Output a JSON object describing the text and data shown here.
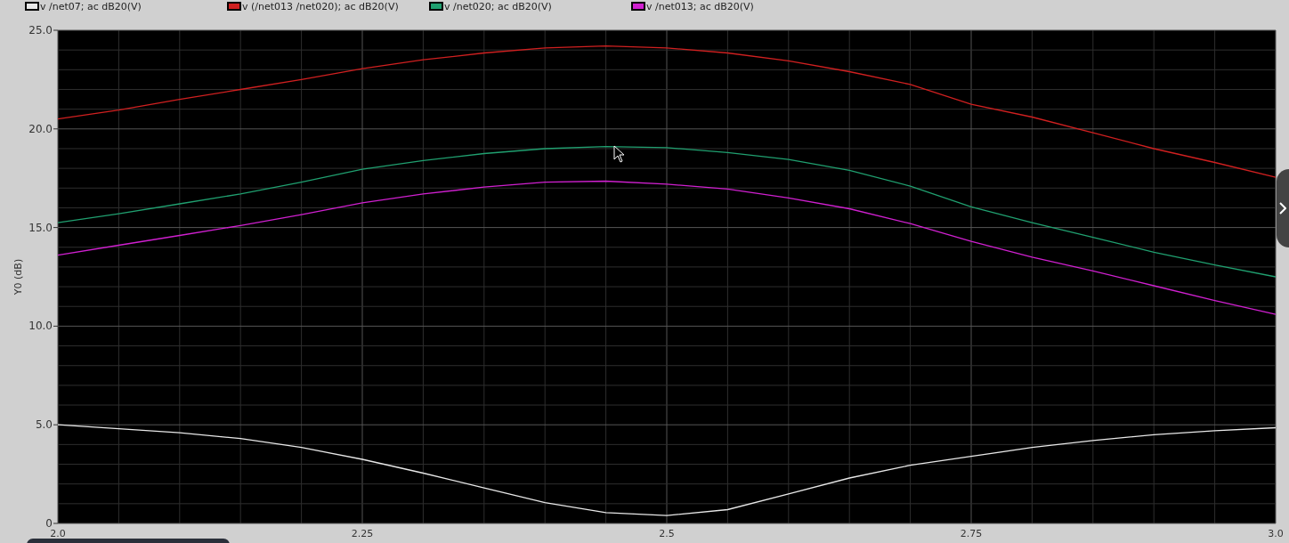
{
  "plot": {
    "chart_data": {
      "type": "line",
      "ylabel": "Y0 (dB)",
      "grid": true,
      "x": [
        2.0,
        2.05,
        2.1,
        2.15,
        2.2,
        2.25,
        2.3,
        2.35,
        2.4,
        2.45,
        2.5,
        2.55,
        2.6,
        2.65,
        2.7,
        2.75,
        2.8,
        2.85,
        2.9,
        2.95,
        3.0
      ],
      "series": [
        {
          "name": "v /net07; ac dB20(V)",
          "color": "#e8e8e8",
          "values": [
            5.0,
            4.8,
            4.6,
            4.3,
            3.85,
            3.25,
            2.55,
            1.8,
            1.05,
            0.55,
            0.4,
            0.7,
            1.5,
            2.3,
            2.95,
            3.4,
            3.85,
            4.2,
            4.5,
            4.7,
            4.85
          ]
        },
        {
          "name": "v (/net013 /net020); ac dB20(V)",
          "color": "#d02020",
          "values": [
            20.5,
            20.95,
            21.5,
            22.0,
            22.5,
            23.05,
            23.5,
            23.85,
            24.1,
            24.2,
            24.1,
            23.85,
            23.45,
            22.9,
            22.25,
            21.25,
            20.6,
            19.8,
            19.0,
            18.3,
            17.55
          ]
        },
        {
          "name": "v /net020; ac dB20(V)",
          "color": "#20a070",
          "values": [
            15.25,
            15.7,
            16.2,
            16.7,
            17.3,
            17.95,
            18.4,
            18.75,
            19.0,
            19.1,
            19.05,
            18.8,
            18.45,
            17.9,
            17.1,
            16.05,
            15.25,
            14.5,
            13.75,
            13.1,
            12.5
          ]
        },
        {
          "name": "v /net013; ac dB20(V)",
          "color": "#d020d0",
          "values": [
            13.6,
            14.1,
            14.6,
            15.1,
            15.65,
            16.25,
            16.7,
            17.05,
            17.3,
            17.35,
            17.2,
            16.95,
            16.5,
            15.95,
            15.2,
            14.3,
            13.5,
            12.8,
            12.05,
            11.3,
            10.6
          ]
        }
      ],
      "xlim": [
        2.0,
        3.0
      ],
      "ylim": [
        0,
        25
      ],
      "xticks": [
        {
          "value": 2.0,
          "label": "2.0"
        },
        2.25,
        2.5,
        2.75,
        {
          "value": 3.0,
          "label": "3.0"
        }
      ],
      "yticks": [
        0,
        {
          "value": 5,
          "label": "5.0"
        },
        {
          "value": 10,
          "label": "10.0"
        },
        {
          "value": 15,
          "label": "15.0"
        },
        {
          "value": 20,
          "label": "20.0"
        },
        {
          "value": 25,
          "label": "25.0"
        }
      ]
    }
  }
}
